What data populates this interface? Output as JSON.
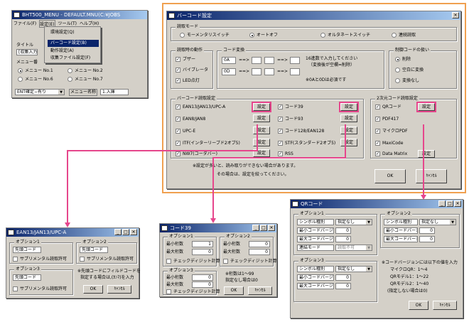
{
  "main": {
    "title": "BHT500_MENU - DEFAULT.MNU(C:¥JOBS",
    "menu": [
      "ファイル(F)",
      "設定(E)",
      "ツール(T)",
      "ヘルプ(H)"
    ],
    "dropdown": [
      "環境設定(Q)",
      "バーコード設定(B)",
      "動作設定(A)",
      "収集ファイル設定(F)"
    ],
    "title_label": "タイトル",
    "title_val": "[収集入力",
    "menu_label": "メニュー番",
    "radios": [
      "メニュー No.1",
      "メニュー No.2",
      "メニュー No.6",
      "メニュー No.7"
    ],
    "ent_sel": "ENT確定−有り",
    "menu_name_label": "メニュー名称",
    "menu_name_val": "1.入庫"
  },
  "barcode": {
    "title": "バーコード設定",
    "mode_label": "読取モード",
    "modes": [
      "モーメンタリスイッチ",
      "オートオフ",
      "オルタネートスイッチ",
      "連続読取"
    ],
    "action_label": "読取時の動作",
    "actions": [
      "ブザー",
      "バイブレータ",
      "LED点灯"
    ],
    "conv_label": "コード変換",
    "conv": [
      "0A",
      "0D"
    ],
    "arrow": "==>",
    "note1": "16進数で入力してください",
    "note2": "（変換後が空欄=削除）",
    "note3": "※0Aと0Dは必須です",
    "ctrl_label": "制御コードの扱い",
    "ctrl": [
      "削除",
      "空白に変換",
      "変換なし"
    ],
    "bc_label": "バーコード読取設定",
    "codes_l": [
      "EAN13/JAN13/UPC-A",
      "EAN8/JAN8",
      "UPC-E",
      "ITF(インターリーブド2オブ5)",
      "NW7(コーダバー)"
    ],
    "codes_r": [
      "コード39",
      "コード93",
      "コード128/EAN128",
      "STF(スタンダード2オブ5)",
      "RSS"
    ],
    "set": "設定",
    "twod_label": "2次元コード読取設定",
    "twod": [
      "QRコード",
      "PDF417",
      "マイクロPDF",
      "MaxiCode",
      "Data Matrix"
    ],
    "warn1": "※設定が多いと、読み取りができない場合があります。",
    "warn2": "その場合は、設定を絞ってください。",
    "ok": "OK",
    "cancel": "ｷｬﾝｾﾙ"
  },
  "ean": {
    "title": "EAN13/JAN13/UPC-A",
    "o1": "オプション1",
    "o2": "オプション2",
    "o3": "オプション3",
    "lead": "先頭コード",
    "sup": "サプリメンタル読取許可",
    "note1": "※先頭コードにフィルドコードを",
    "note2": "指定する場合は,(ｶﾝﾏ)を入力",
    "ok": "OK",
    "cancel": "ｷｬﾝｾﾙ"
  },
  "c39": {
    "title": "コード39",
    "o1": "オプション1",
    "o2": "オプション2",
    "o3": "オプション3",
    "min": "最小桁数",
    "max": "最大桁数",
    "v1": "1",
    "v0": "0",
    "chk": "チェックディジット計算",
    "note1": "※桁数は1〜99",
    "note2": "指定なし場合は0",
    "ok": "OK",
    "cancel": "ｷｬﾝｾﾙ"
  },
  "qr": {
    "title": "QRコード",
    "o1": "オプション1",
    "o2": "オプション2",
    "o3": "オプション3",
    "sym": "シンボル種別",
    "sel": "指定なし",
    "min": "最小コードバージョン",
    "max": "最大コードバージョン",
    "v0": "0",
    "link": "連結モード",
    "link_val": "読取不可",
    "note1": "※コードバージョンには以下の値を入力",
    "note2": "マイクロQR：1〜4",
    "note3": "QRモデル1：1〜22",
    "note4": "QRモデル2：1〜40",
    "note5": "(指定しない場合は0)",
    "ok": "OK",
    "cancel": "ｷｬﾝｾﾙ"
  },
  "colors": {
    "highlight": "#e6468c",
    "frame": "#f0a050",
    "title": "#0a246a"
  }
}
